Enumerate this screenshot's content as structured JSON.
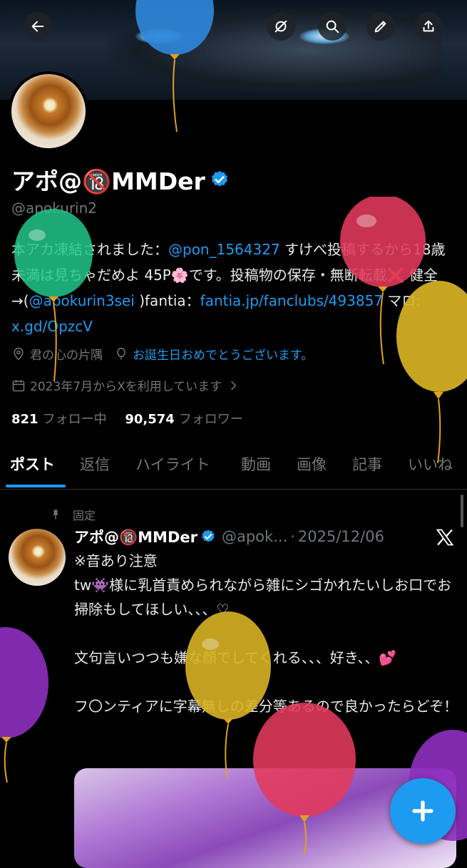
{
  "profile": {
    "name": "アポ@🔞MMDer",
    "handle": "@apokurin2",
    "bio_parts": {
      "p1": "本アカ凍結されました：",
      "link1": "@pon_1564327",
      "p2": " すけべ投稿するから18歳未満は見ちゃだめよ 45P🌸です。投稿物の保存・無断転載❌ 健全→(",
      "link2": "@apokurin3sei",
      "p3": " )fantia：",
      "link3": "fantia.jp/fanclubs/493857",
      "p4": " マロ: ",
      "link4": "x.gd/OpzcV"
    },
    "location": "君の心の片隅",
    "birthday": "お誕生日おめでとうございます。",
    "joined": "2023年7月からXを利用しています",
    "following_count": "821",
    "following_label": "フォロー中",
    "followers_count": "90,574",
    "followers_label": "フォロワー"
  },
  "tabs": [
    "ポスト",
    "返信",
    "ハイライト",
    "動画",
    "画像",
    "記事",
    "いいね"
  ],
  "post": {
    "pinned_label": "固定",
    "name": "アポ@🔞MMDer",
    "handle": "@apok...",
    "date": "2025/12/06",
    "text": "※音あり注意\ntw👾様に乳首責められながら雑にシゴかれたいしお口でお掃除もしてほしい、、、♡\n\n文句言いつつも嫌な顔でしてくれる、、、好き、、💕\n\nフ〇ンティアに字幕無しの差分等あるので良かったらどぞ！"
  },
  "icons": {
    "back": "arrow-left-icon",
    "rotate": "rotate-off-icon",
    "search": "search-icon",
    "edit": "pencil-icon",
    "share": "share-icon",
    "compose": "plus-icon"
  },
  "colors": {
    "accent": "#1d9bf0",
    "muted": "#71767b",
    "background": "#000000"
  }
}
